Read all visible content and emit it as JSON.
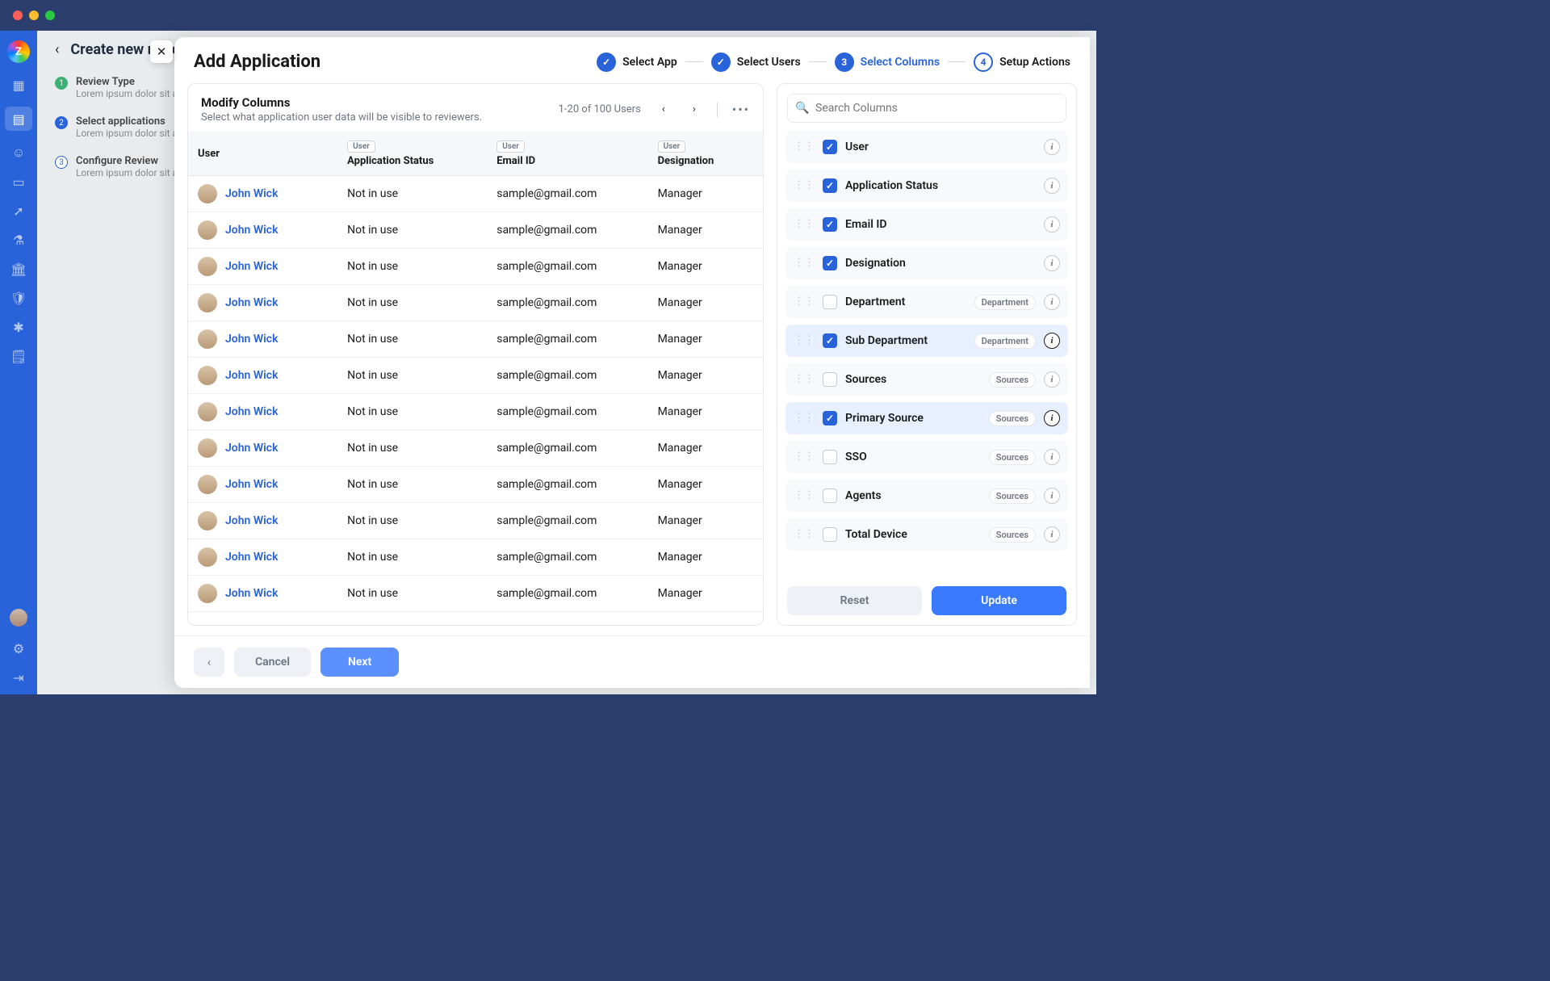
{
  "window": {
    "logo_letter": "Z"
  },
  "bg": {
    "back_header": "Create new review",
    "steps": [
      {
        "num": "1",
        "title": "Review Type",
        "sub": "Lorem ipsum dolor sit amet"
      },
      {
        "num": "2",
        "title": "Select applications",
        "sub": "Lorem ipsum dolor sit amet"
      },
      {
        "num": "3",
        "title": "Configure Review",
        "sub": "Lorem ipsum dolor sit amet"
      }
    ]
  },
  "modal": {
    "title": "Add Application",
    "stepper": [
      {
        "label": "Select App",
        "mark": "✓",
        "state": "done"
      },
      {
        "label": "Select Users",
        "mark": "✓",
        "state": "done"
      },
      {
        "label": "Select Columns",
        "mark": "3",
        "state": "active"
      },
      {
        "label": "Setup Actions",
        "mark": "4",
        "state": "outline"
      }
    ],
    "table": {
      "title": "Modify Columns",
      "subtitle": "Select what application user data will be visible to reviewers.",
      "pager": "1-20 of 100 Users",
      "header_pill": "User",
      "headers": [
        "User",
        "Application Status",
        "Email ID",
        "Designation"
      ],
      "rows": [
        {
          "name": "John Wick",
          "status": "Not in use",
          "email": "sample@gmail.com",
          "desig": "Manager"
        },
        {
          "name": "John Wick",
          "status": "Not in use",
          "email": "sample@gmail.com",
          "desig": "Manager"
        },
        {
          "name": "John Wick",
          "status": "Not in use",
          "email": "sample@gmail.com",
          "desig": "Manager"
        },
        {
          "name": "John Wick",
          "status": "Not in use",
          "email": "sample@gmail.com",
          "desig": "Manager"
        },
        {
          "name": "John Wick",
          "status": "Not in use",
          "email": "sample@gmail.com",
          "desig": "Manager"
        },
        {
          "name": "John Wick",
          "status": "Not in use",
          "email": "sample@gmail.com",
          "desig": "Manager"
        },
        {
          "name": "John Wick",
          "status": "Not in use",
          "email": "sample@gmail.com",
          "desig": "Manager"
        },
        {
          "name": "John Wick",
          "status": "Not in use",
          "email": "sample@gmail.com",
          "desig": "Manager"
        },
        {
          "name": "John Wick",
          "status": "Not in use",
          "email": "sample@gmail.com",
          "desig": "Manager"
        },
        {
          "name": "John Wick",
          "status": "Not in use",
          "email": "sample@gmail.com",
          "desig": "Manager"
        },
        {
          "name": "John Wick",
          "status": "Not in use",
          "email": "sample@gmail.com",
          "desig": "Manager"
        },
        {
          "name": "John Wick",
          "status": "Not in use",
          "email": "sample@gmail.com",
          "desig": "Manager"
        }
      ]
    },
    "columns_panel": {
      "search_placeholder": "Search Columns",
      "items": [
        {
          "label": "User",
          "checked": true,
          "badge": "",
          "hi": false
        },
        {
          "label": "Application Status",
          "checked": true,
          "badge": "",
          "hi": false
        },
        {
          "label": "Email ID",
          "checked": true,
          "badge": "",
          "hi": false
        },
        {
          "label": "Designation",
          "checked": true,
          "badge": "",
          "hi": false
        },
        {
          "label": "Department",
          "checked": false,
          "badge": "Department",
          "hi": false
        },
        {
          "label": "Sub Department",
          "checked": true,
          "badge": "Department",
          "hi": true
        },
        {
          "label": "Sources",
          "checked": false,
          "badge": "Sources",
          "hi": false
        },
        {
          "label": "Primary Source",
          "checked": true,
          "badge": "Sources",
          "hi": true
        },
        {
          "label": "SSO",
          "checked": false,
          "badge": "Sources",
          "hi": false
        },
        {
          "label": "Agents",
          "checked": false,
          "badge": "Sources",
          "hi": false
        },
        {
          "label": "Total Device",
          "checked": false,
          "badge": "Sources",
          "hi": false
        }
      ],
      "reset": "Reset",
      "update": "Update"
    },
    "footer": {
      "cancel": "Cancel",
      "next": "Next"
    }
  }
}
